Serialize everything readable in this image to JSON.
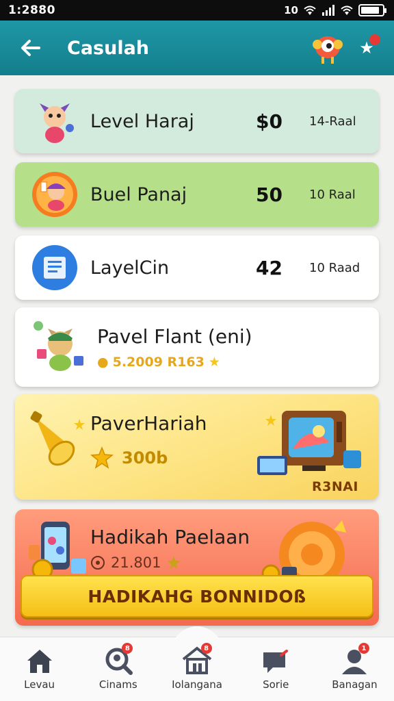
{
  "status_bar": {
    "time": "1:2880",
    "network": "10"
  },
  "header": {
    "title": "Casulah"
  },
  "rows": [
    {
      "label": "Level Haraj",
      "points": "$0",
      "per": "14-Raal"
    },
    {
      "label": "Buel Panaj",
      "points": "50",
      "per": "10 Raal"
    },
    {
      "label": "LayelCin",
      "points": "42",
      "per": "10 Raad"
    }
  ],
  "promo": {
    "title": "Pavel Flant (eni)",
    "subtitle": "5.2009 R163"
  },
  "reward_card": {
    "title": "PaverHariah",
    "amount": "300b",
    "badge": "R3NAI"
  },
  "bonus_card": {
    "title": "Hadikah Paelaan",
    "amount": "21.801",
    "button_label": "HADIKAHG BONNIDOß"
  },
  "bottom_nav": [
    {
      "label": "Levau"
    },
    {
      "label": "Cinams",
      "badge": "8"
    },
    {
      "label": "Iolangana",
      "badge": "8"
    },
    {
      "label": "Sorie"
    },
    {
      "label": "Banagan",
      "badge": "1"
    }
  ],
  "colors": {
    "appbar": "#1a8c9a",
    "accent_yellow": "#f5bf16",
    "accent_coral": "#f56a4f"
  }
}
